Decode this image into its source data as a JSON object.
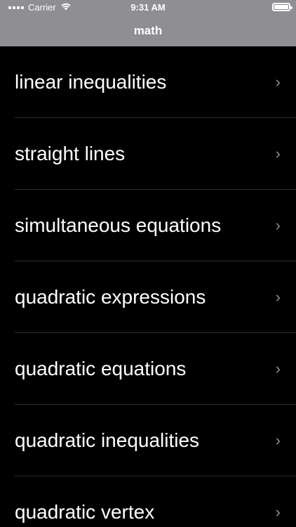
{
  "status_bar": {
    "carrier": "Carrier",
    "time": "9:31 AM",
    "battery_level_fraction": 1.0
  },
  "nav": {
    "title": "math"
  },
  "list": {
    "items": [
      {
        "label": "linear inequalities",
        "accessory": "chevron-right"
      },
      {
        "label": "straight lines",
        "accessory": "chevron-right"
      },
      {
        "label": "simultaneous equations",
        "accessory": "chevron-right"
      },
      {
        "label": "quadratic expressions",
        "accessory": "chevron-right"
      },
      {
        "label": "quadratic equations",
        "accessory": "chevron-right"
      },
      {
        "label": "quadratic inequalities",
        "accessory": "chevron-right"
      },
      {
        "label": "quadratic vertex",
        "accessory": "chevron-right"
      }
    ]
  },
  "colors": {
    "topbar_bg": "#8e8e93",
    "list_bg": "#000000",
    "text": "#ffffff",
    "chevron": "#8e8e93",
    "separator": "#2c2c2e"
  }
}
